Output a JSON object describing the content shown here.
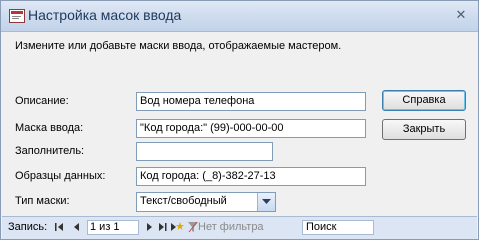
{
  "window": {
    "title": "Настройка масок ввода",
    "close_glyph": "✕"
  },
  "prompt": "Измените или добавьте маски ввода, отображаемые мастером.",
  "fields": {
    "description": {
      "label": "Описание:",
      "value": "Вод номера телефона"
    },
    "input_mask": {
      "label": "Маска ввода:",
      "value": "\"Код города:\" (99)-000-00-00"
    },
    "placeholder": {
      "label": "Заполнитель:",
      "value": ""
    },
    "sample_data": {
      "label": "Образцы данных:",
      "value": "Код города: (_8)-382-27-13"
    },
    "mask_type": {
      "label": "Тип маски:",
      "value": "Текст/свободный"
    }
  },
  "buttons": {
    "help": "Справка",
    "close": "Закрыть"
  },
  "statusbar": {
    "record_label": "Запись:",
    "record_value": "1 из 1",
    "filter_label": "Нет фильтра",
    "search_label": "Поиск"
  },
  "icons": [
    "app-icon",
    "close-icon",
    "first-record-icon",
    "prev-record-icon",
    "next-record-icon",
    "last-record-icon",
    "new-record-icon",
    "filter-icon",
    "chevron-down-icon"
  ]
}
